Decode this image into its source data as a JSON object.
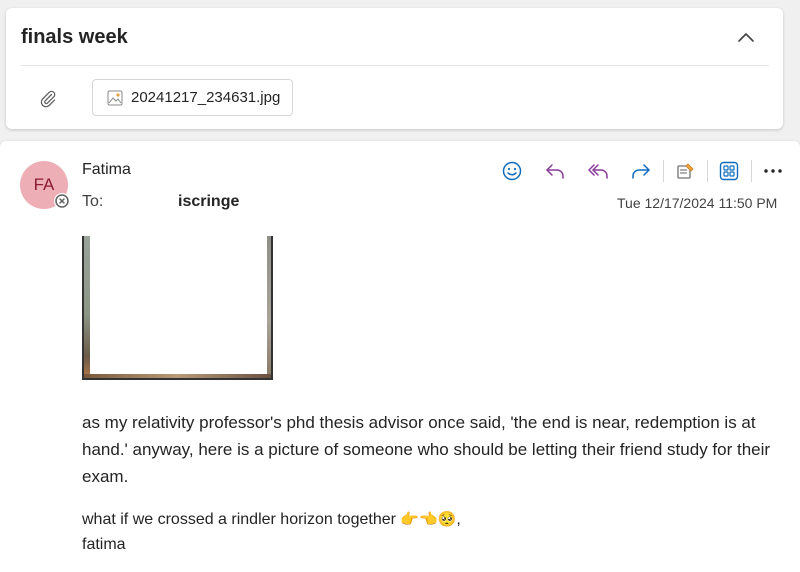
{
  "subject": {
    "title": "finals week"
  },
  "attachment": {
    "filename": "20241217_234631.jpg"
  },
  "message": {
    "avatar_initials": "FA",
    "sender": "Fatima",
    "to_label": "To:",
    "to_name": "iscringe",
    "timestamp": "Tue 12/17/2024 11:50 PM",
    "body": "as my relativity professor's phd thesis advisor once said, 'the end is near, redemption is at hand.' anyway, here is a picture of someone who should be letting their friend study for their exam.",
    "signoff_line1": "what if we crossed a rindler horizon together",
    "signoff_emoji": "👉👈🥺",
    "signoff_comma": ",",
    "signoff_line2": "fatima"
  },
  "toolbar": {
    "icons": [
      "smiley-icon",
      "reply-icon",
      "reply-all-icon",
      "forward-icon",
      "immersive-reader-icon",
      "apps-icon",
      "more-icon"
    ]
  },
  "colors": {
    "accent_blue": "#0f6cbd",
    "reply_purple": "#8a3a9a",
    "avatar_bg": "#eeaeb6",
    "avatar_fg": "#8a1c33"
  }
}
